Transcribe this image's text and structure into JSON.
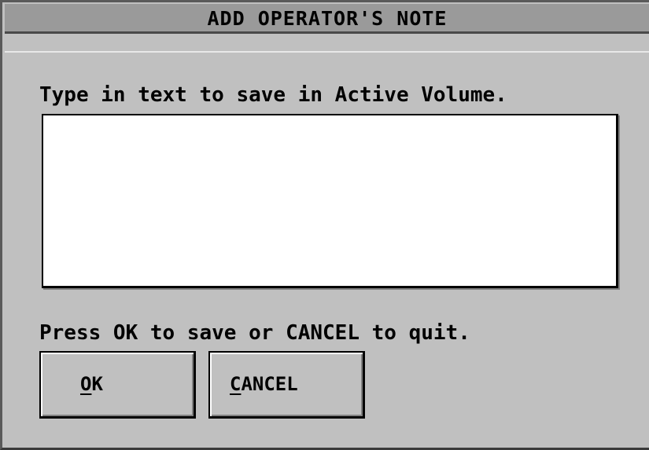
{
  "dialog": {
    "title": "ADD OPERATOR'S NOTE",
    "prompt": "Type in text to save in Active Volume.",
    "note_value": "",
    "instruction": "Press OK to save or CANCEL to quit.",
    "ok_button": {
      "mnemonic": "O",
      "rest": "K"
    },
    "cancel_button": {
      "mnemonic": "C",
      "rest": "ANCEL"
    }
  }
}
